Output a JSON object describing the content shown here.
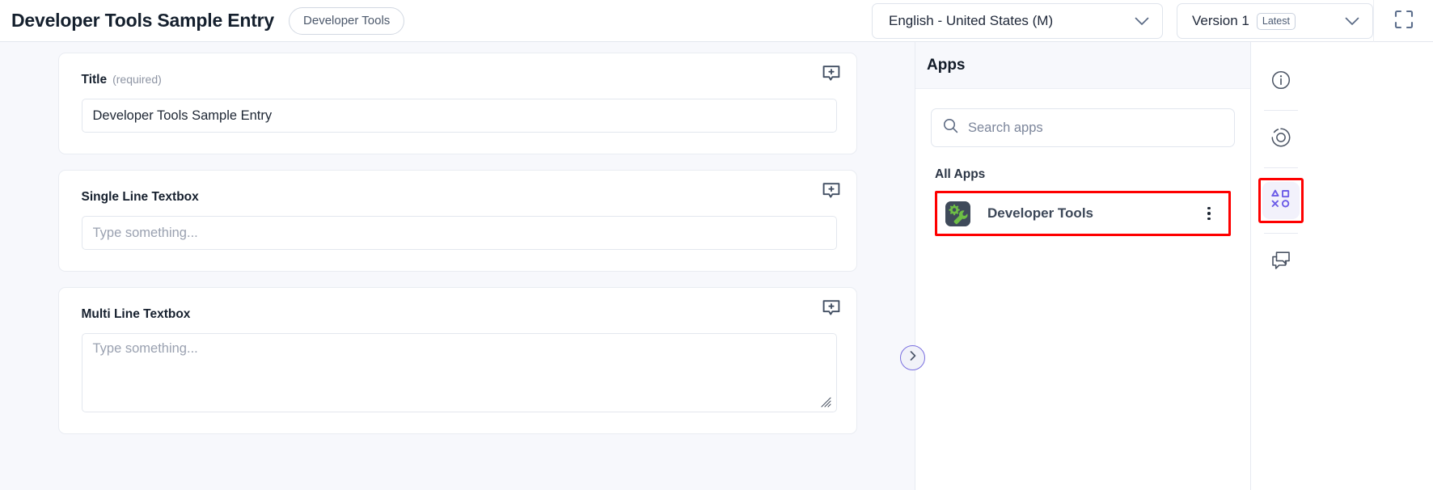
{
  "header": {
    "title": "Developer Tools Sample Entry",
    "chip_label": "Developer Tools",
    "language_select": {
      "value": "English - United States (M)",
      "icon": "chevron-down-icon"
    },
    "version_select": {
      "value": "Version 1",
      "badge": "Latest",
      "icon": "chevron-down-icon"
    },
    "expand_icon": "fullscreen-expand-icon"
  },
  "form": {
    "fields": [
      {
        "label": "Title",
        "required_note": "(required)",
        "type": "single-line",
        "value": "Developer Tools Sample Entry",
        "placeholder": "",
        "comment_icon": "add-comment-icon"
      },
      {
        "label": "Single Line Textbox",
        "required_note": "",
        "type": "single-line",
        "value": "",
        "placeholder": "Type something...",
        "comment_icon": "add-comment-icon"
      },
      {
        "label": "Multi Line Textbox",
        "required_note": "",
        "type": "multi-line",
        "value": "",
        "placeholder": "Type something...",
        "comment_icon": "add-comment-icon"
      }
    ]
  },
  "apps_panel": {
    "title": "Apps",
    "search": {
      "placeholder": "Search apps",
      "value": "",
      "icon": "search-icon"
    },
    "section_label": "All Apps",
    "apps": [
      {
        "name": "Developer Tools",
        "icon": "gear-wrench-icon",
        "menu_icon": "kebab-menu-icon",
        "highlighted": true
      }
    ]
  },
  "collapse_toggle": {
    "icon": "chevron-right-icon"
  },
  "rail": {
    "items": [
      {
        "icon": "info-icon",
        "name": "details",
        "active": false,
        "highlighted": false
      },
      {
        "icon": "target-icon",
        "name": "tracking",
        "active": false,
        "highlighted": false
      },
      {
        "icon": "shapes-apps-icon",
        "name": "apps",
        "active": true,
        "highlighted": true
      },
      {
        "icon": "comments-icon",
        "name": "comments",
        "active": false,
        "highlighted": false
      }
    ]
  },
  "colors": {
    "accent_purple": "#6c5ce7",
    "highlight_red": "#fe0000",
    "app_icon_green": "#6dbe45",
    "app_icon_bg": "#3f4a5a",
    "page_bg": "#f7f8fc"
  }
}
